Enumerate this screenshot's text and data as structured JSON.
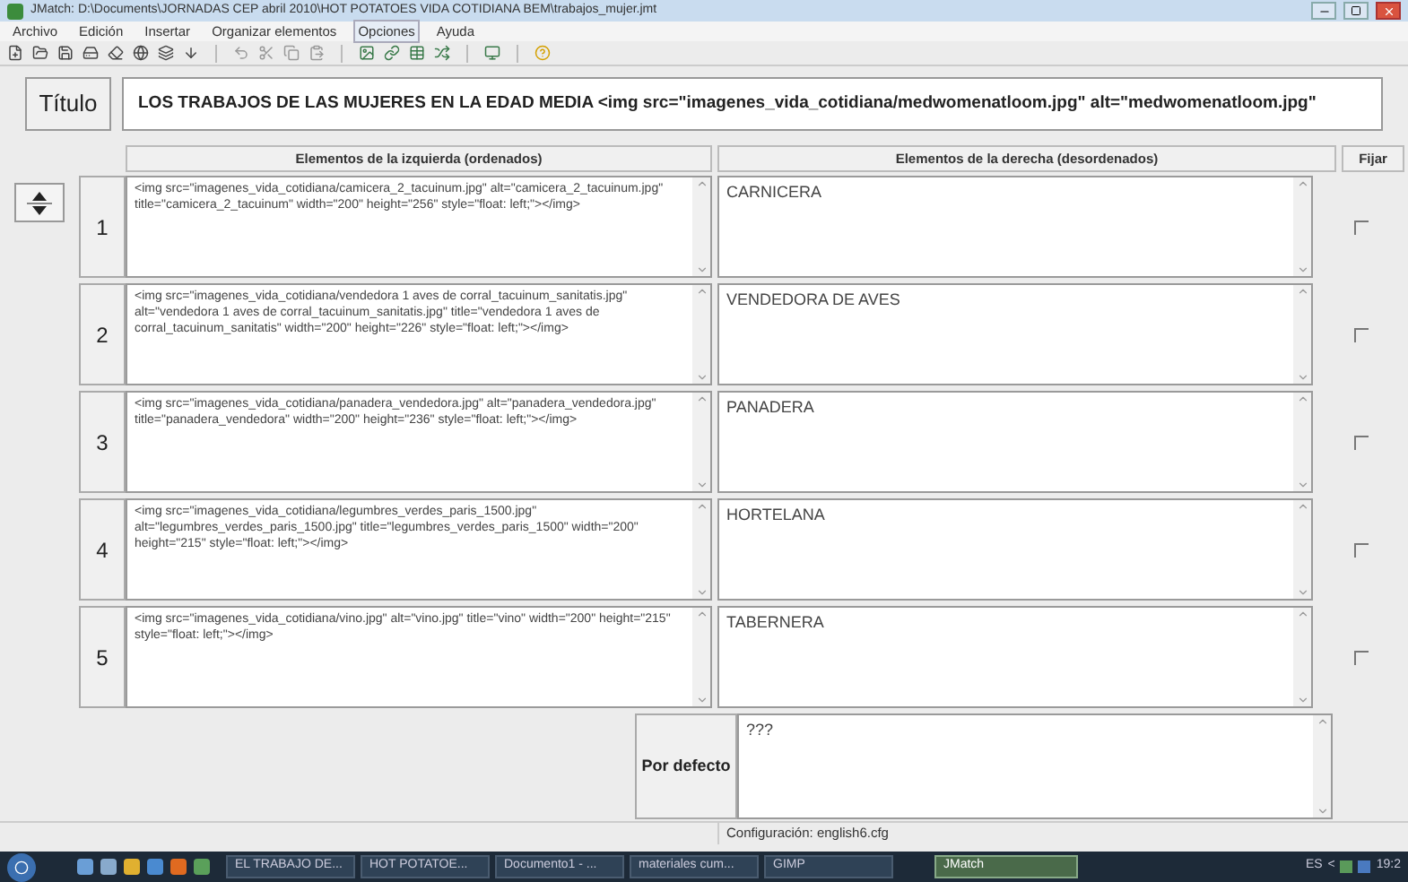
{
  "window": {
    "title": "JMatch: D:\\Documents\\JORNADAS CEP abril 2010\\HOT POTATOES VIDA COTIDIANA BEM\\trabajos_mujer.jmt"
  },
  "menu": [
    {
      "label": "Archivo",
      "selected": false
    },
    {
      "label": "Edición",
      "selected": false
    },
    {
      "label": "Insertar",
      "selected": false
    },
    {
      "label": "Organizar elementos",
      "selected": false
    },
    {
      "label": "Opciones",
      "selected": true
    },
    {
      "label": "Ayuda",
      "selected": false
    }
  ],
  "title_label": "Título",
  "title_value": "LOS TRABAJOS DE LAS MUJERES EN LA EDAD MEDIA  <img src=\"imagenes_vida_cotidiana/medwomenatloom.jpg\" alt=\"medwomenatloom.jpg\"",
  "headers": {
    "left": "Elementos de la izquierda (ordenados)",
    "right": "Elementos de la derecha (desordenados)",
    "fix": "Fijar"
  },
  "rows": [
    {
      "number": "1",
      "left": "<img src=\"imagenes_vida_cotidiana/camicera_2_tacuinum.jpg\" alt=\"camicera_2_tacuinum.jpg\" title=\"camicera_2_tacuinum\" width=\"200\" height=\"256\" style=\"float: left;\"></img>",
      "right": "CARNICERA",
      "fixed": false
    },
    {
      "number": "2",
      "left": "<img src=\"imagenes_vida_cotidiana/vendedora 1 aves de corral_tacuinum_sanitatis.jpg\" alt=\"vendedora 1 aves de corral_tacuinum_sanitatis.jpg\" title=\"vendedora 1 aves de corral_tacuinum_sanitatis\" width=\"200\" height=\"226\" style=\"float: left;\"></img>",
      "right": "VENDEDORA DE AVES",
      "fixed": false
    },
    {
      "number": "3",
      "left": "<img src=\"imagenes_vida_cotidiana/panadera_vendedora.jpg\" alt=\"panadera_vendedora.jpg\" title=\"panadera_vendedora\" width=\"200\" height=\"236\" style=\"float: left;\"></img>",
      "right": "PANADERA",
      "fixed": false
    },
    {
      "number": "4",
      "left": "<img src=\"imagenes_vida_cotidiana/legumbres_verdes_paris_1500.jpg\" alt=\"legumbres_verdes_paris_1500.jpg\" title=\"legumbres_verdes_paris_1500\" width=\"200\" height=\"215\" style=\"float: left;\"></img>",
      "right": "HORTELANA",
      "fixed": false
    },
    {
      "number": "5",
      "left": "<img src=\"imagenes_vida_cotidiana/vino.jpg\" alt=\"vino.jpg\" title=\"vino\" width=\"200\" height=\"215\" style=\"float: left;\"></img>",
      "right": "TABERNERA",
      "fixed": false
    }
  ],
  "default": {
    "label": "Por defecto",
    "value": "???"
  },
  "status_bar": "Configuración: english6.cfg",
  "taskbar": {
    "items": [
      {
        "label": "EL TRABAJO DE...",
        "selected": false
      },
      {
        "label": "HOT POTATOE...",
        "selected": false
      },
      {
        "label": "Documento1 - ...",
        "selected": false
      },
      {
        "label": "materiales cum...",
        "selected": false
      },
      {
        "label": "GIMP",
        "selected": false
      },
      {
        "label": "JMatch",
        "selected": true
      }
    ],
    "language": "ES",
    "chevron": "<",
    "clock": "19:2"
  }
}
